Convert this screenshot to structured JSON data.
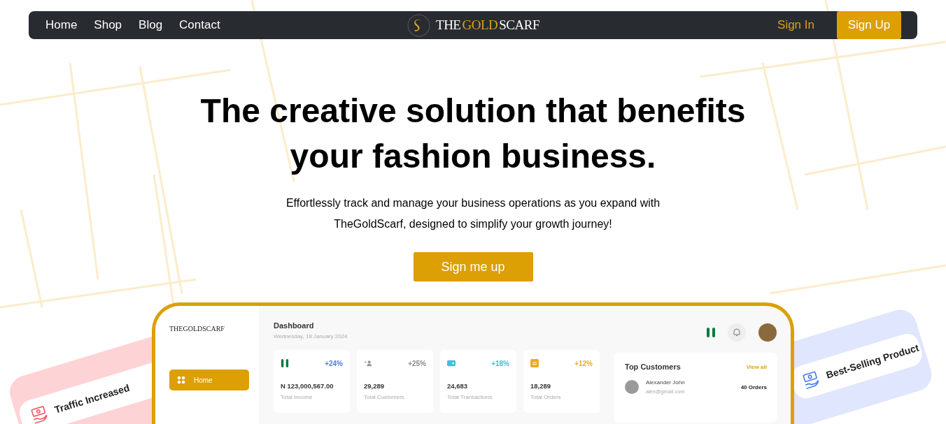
{
  "nav": {
    "links": [
      {
        "label": "Home"
      },
      {
        "label": "Shop"
      },
      {
        "label": "Blog"
      },
      {
        "label": "Contact"
      }
    ],
    "logo": [
      {
        "text": "THE",
        "accent": false
      },
      {
        "text": "GOLD",
        "accent": true
      },
      {
        "text": "SCARF",
        "accent": false
      }
    ],
    "sign_in": "Sign In",
    "sign_up": "Sign Up"
  },
  "hero": {
    "title": "The creative solution that benefits your fashion business.",
    "subtitle": "Effortlessly track and manage your business operations as you expand with TheGoldScarf, designed to simplify your growth journey!",
    "button": "Sign me up"
  },
  "floating_cards": [
    {
      "label": "Traffic Increased",
      "color": "#f05a64"
    },
    {
      "label": "Best-Selling Product",
      "color": "#4a7cf0"
    }
  ],
  "dashboard": {
    "brand": "THEGOLDSCARF",
    "sidebar": [
      {
        "label": "Home",
        "selected": true
      }
    ],
    "title": "Dashboard",
    "date": "Wednesday, 18 January 2024",
    "stats": [
      {
        "kind": "flag",
        "change": "+24%",
        "color": "#4a7cf0",
        "value": "N 123,000,567.00",
        "label": "Total Income"
      },
      {
        "kind": "users",
        "change": "+25%",
        "color": "#8a8a8a",
        "value": "29,289",
        "label": "Total Customers"
      },
      {
        "kind": "wallet",
        "change": "+18%",
        "color": "#3bbfe0",
        "value": "24,683",
        "label": "Total Transactions"
      },
      {
        "kind": "orders",
        "change": "+12%",
        "color": "#f5a623",
        "value": "18,289",
        "label": "Total Orders"
      }
    ],
    "top_customers": {
      "title": "Top Customers",
      "link": "View all",
      "rows": [
        {
          "name": "Alexander John",
          "email": "alex@gmail.com",
          "orders": "40 Orders"
        }
      ]
    }
  }
}
